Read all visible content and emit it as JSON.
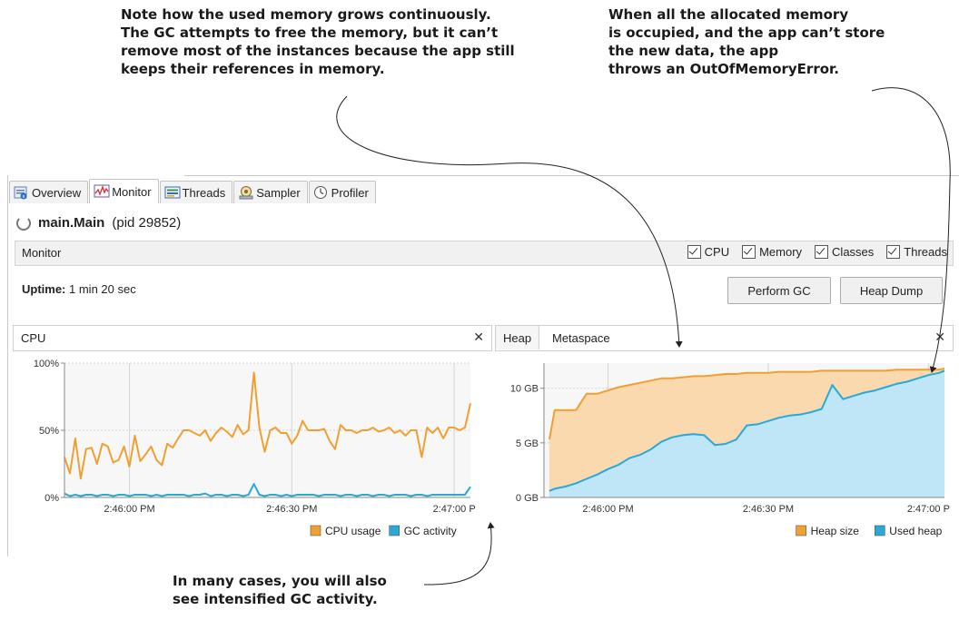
{
  "annotations": {
    "memory_growth": "Note how the used memory grows continuously.\nThe GC attempts to free the memory, but it can’t\nremove most of the instances because the app still\nkeeps their references in memory.",
    "out_of_memory": "When all the allocated memory\nis occupied, and the app can’t store\nthe new data, the app\nthrows an OutOfMemoryError.",
    "gc_activity": "In many cases, you will also\nsee intensified GC activity."
  },
  "tabs": [
    {
      "label": "Overview",
      "icon": "overview-icon"
    },
    {
      "label": "Monitor",
      "icon": "monitor-icon",
      "active": true
    },
    {
      "label": "Threads",
      "icon": "threads-icon"
    },
    {
      "label": "Sampler",
      "icon": "sampler-icon"
    },
    {
      "label": "Profiler",
      "icon": "profiler-icon"
    }
  ],
  "process": {
    "name": "main.Main",
    "pid": "(pid 29852)"
  },
  "monitor": {
    "title": "Monitor",
    "checks": [
      "CPU",
      "Memory",
      "Classes",
      "Threads"
    ],
    "uptime_label": "Uptime:",
    "uptime_value": "1 min 20 sec",
    "perform_gc": "Perform GC",
    "heap_dump": "Heap Dump"
  },
  "cpu_panel": {
    "title": "CPU",
    "close": "✕"
  },
  "heap_panel": {
    "tab_heap": "Heap",
    "tab_meta": "Metaspace",
    "close": "✕"
  },
  "colors": {
    "cpu": "#f0a030",
    "gc": "#2aa8d8",
    "heap_fill": "#fbd9ae",
    "used_fill": "#bfe6f7",
    "heap_line": "#f0a030",
    "used_line": "#2aa8d8"
  },
  "chart_data": [
    {
      "type": "line",
      "title": "CPU",
      "x": [
        "2:45:48",
        "2:45:49",
        "2:45:50",
        "2:45:51",
        "2:45:52",
        "2:45:53",
        "2:45:54",
        "2:45:55",
        "2:45:56",
        "2:45:57",
        "2:45:58",
        "2:45:59",
        "2:46:00",
        "2:46:01",
        "2:46:02",
        "2:46:03",
        "2:46:04",
        "2:46:05",
        "2:46:06",
        "2:46:07",
        "2:46:08",
        "2:46:09",
        "2:46:10",
        "2:46:11",
        "2:46:12",
        "2:46:13",
        "2:46:14",
        "2:46:15",
        "2:46:16",
        "2:46:17",
        "2:46:18",
        "2:46:19",
        "2:46:20",
        "2:46:21",
        "2:46:22",
        "2:46:23",
        "2:46:24",
        "2:46:25",
        "2:46:26",
        "2:46:27",
        "2:46:28",
        "2:46:29",
        "2:46:30",
        "2:46:31",
        "2:46:32",
        "2:46:33",
        "2:46:34",
        "2:46:35",
        "2:46:36",
        "2:46:37",
        "2:46:38",
        "2:46:39",
        "2:46:40",
        "2:46:41",
        "2:46:42",
        "2:46:43",
        "2:46:44",
        "2:46:45",
        "2:46:46",
        "2:46:47",
        "2:46:48",
        "2:46:49",
        "2:46:50",
        "2:46:51",
        "2:46:52",
        "2:46:53",
        "2:46:54",
        "2:46:55",
        "2:46:56",
        "2:46:57",
        "2:46:58",
        "2:46:59",
        "2:47:00",
        "2:47:01",
        "2:47:02",
        "2:47:03"
      ],
      "series": [
        {
          "name": "CPU usage",
          "values": [
            30,
            18,
            44,
            14,
            36,
            37,
            25,
            40,
            38,
            26,
            28,
            38,
            23,
            46,
            27,
            32,
            38,
            28,
            24,
            40,
            37,
            44,
            50,
            50,
            48,
            46,
            50,
            42,
            48,
            52,
            49,
            45,
            54,
            47,
            50,
            93,
            52,
            34,
            50,
            52,
            48,
            48,
            40,
            46,
            57,
            50,
            50,
            50,
            51,
            42,
            36,
            54,
            50,
            50,
            48,
            50,
            50,
            52,
            49,
            50,
            52,
            48,
            50,
            46,
            50,
            50,
            30,
            52,
            48,
            52,
            44,
            52,
            52,
            50,
            52,
            70
          ]
        },
        {
          "name": "GC activity",
          "values": [
            3,
            1,
            2,
            1,
            2,
            2,
            1,
            2,
            2,
            1,
            2,
            2,
            1,
            2,
            2,
            2,
            1,
            2,
            1,
            2,
            2,
            2,
            2,
            1,
            2,
            2,
            3,
            1,
            2,
            2,
            1,
            2,
            2,
            1,
            2,
            10,
            2,
            1,
            2,
            2,
            1,
            2,
            1,
            2,
            2,
            2,
            2,
            1,
            2,
            2,
            2,
            1,
            2,
            2,
            1,
            2,
            2,
            1,
            2,
            2,
            1,
            2,
            2,
            2,
            1,
            2,
            2,
            1,
            2,
            2,
            2,
            2,
            2,
            2,
            2,
            8
          ]
        }
      ],
      "y_ticks": [
        "0%",
        "50%",
        "100%"
      ],
      "x_ticks": [
        "2:46:00 PM",
        "2:46:30 PM",
        "2:47:00 P"
      ],
      "ylim": [
        0,
        100
      ]
    },
    {
      "type": "area",
      "title": "Heap",
      "x": [
        "2:45:49",
        "2:45:50",
        "2:45:52",
        "2:45:54",
        "2:45:56",
        "2:45:58",
        "2:46:00",
        "2:46:02",
        "2:46:04",
        "2:46:06",
        "2:46:08",
        "2:46:10",
        "2:46:12",
        "2:46:14",
        "2:46:16",
        "2:46:18",
        "2:46:20",
        "2:46:22",
        "2:46:24",
        "2:46:26",
        "2:46:28",
        "2:46:30",
        "2:46:32",
        "2:46:34",
        "2:46:36",
        "2:46:38",
        "2:46:40",
        "2:46:42",
        "2:46:44",
        "2:46:46",
        "2:46:48",
        "2:46:50",
        "2:46:52",
        "2:46:54",
        "2:46:56",
        "2:46:58",
        "2:47:00",
        "2:47:02",
        "2:47:03"
      ],
      "series": [
        {
          "name": "Heap size",
          "values": [
            5.3,
            8.0,
            8.0,
            8.0,
            9.5,
            9.5,
            9.8,
            10.1,
            10.3,
            10.5,
            10.7,
            10.9,
            10.9,
            11.0,
            11.1,
            11.1,
            11.2,
            11.3,
            11.3,
            11.4,
            11.4,
            11.4,
            11.5,
            11.5,
            11.5,
            11.5,
            11.6,
            11.6,
            11.6,
            11.6,
            11.6,
            11.6,
            11.6,
            11.7,
            11.7,
            11.7,
            11.7,
            11.7,
            11.8
          ]
        },
        {
          "name": "Used heap",
          "values": [
            0.6,
            0.8,
            1.0,
            1.3,
            1.7,
            2.1,
            2.6,
            3.0,
            3.6,
            3.9,
            4.4,
            5.1,
            5.5,
            5.7,
            5.8,
            5.7,
            4.8,
            4.9,
            5.3,
            6.6,
            6.7,
            7.0,
            7.3,
            7.5,
            7.6,
            7.8,
            8.1,
            10.3,
            9.0,
            9.3,
            9.6,
            9.8,
            10.1,
            10.4,
            10.6,
            10.9,
            11.2,
            11.4,
            11.6
          ]
        }
      ],
      "y_ticks": [
        "0 GB",
        "5 GB",
        "10 GB"
      ],
      "x_ticks": [
        "2:46:00 PM",
        "2:46:30 PM",
        "2:47:00 P"
      ],
      "ylim": [
        0,
        12.3
      ]
    }
  ],
  "legends": {
    "cpu": [
      {
        "label": "CPU usage"
      },
      {
        "label": "GC activity"
      }
    ],
    "heap": [
      {
        "label": "Heap size"
      },
      {
        "label": "Used heap"
      }
    ]
  }
}
